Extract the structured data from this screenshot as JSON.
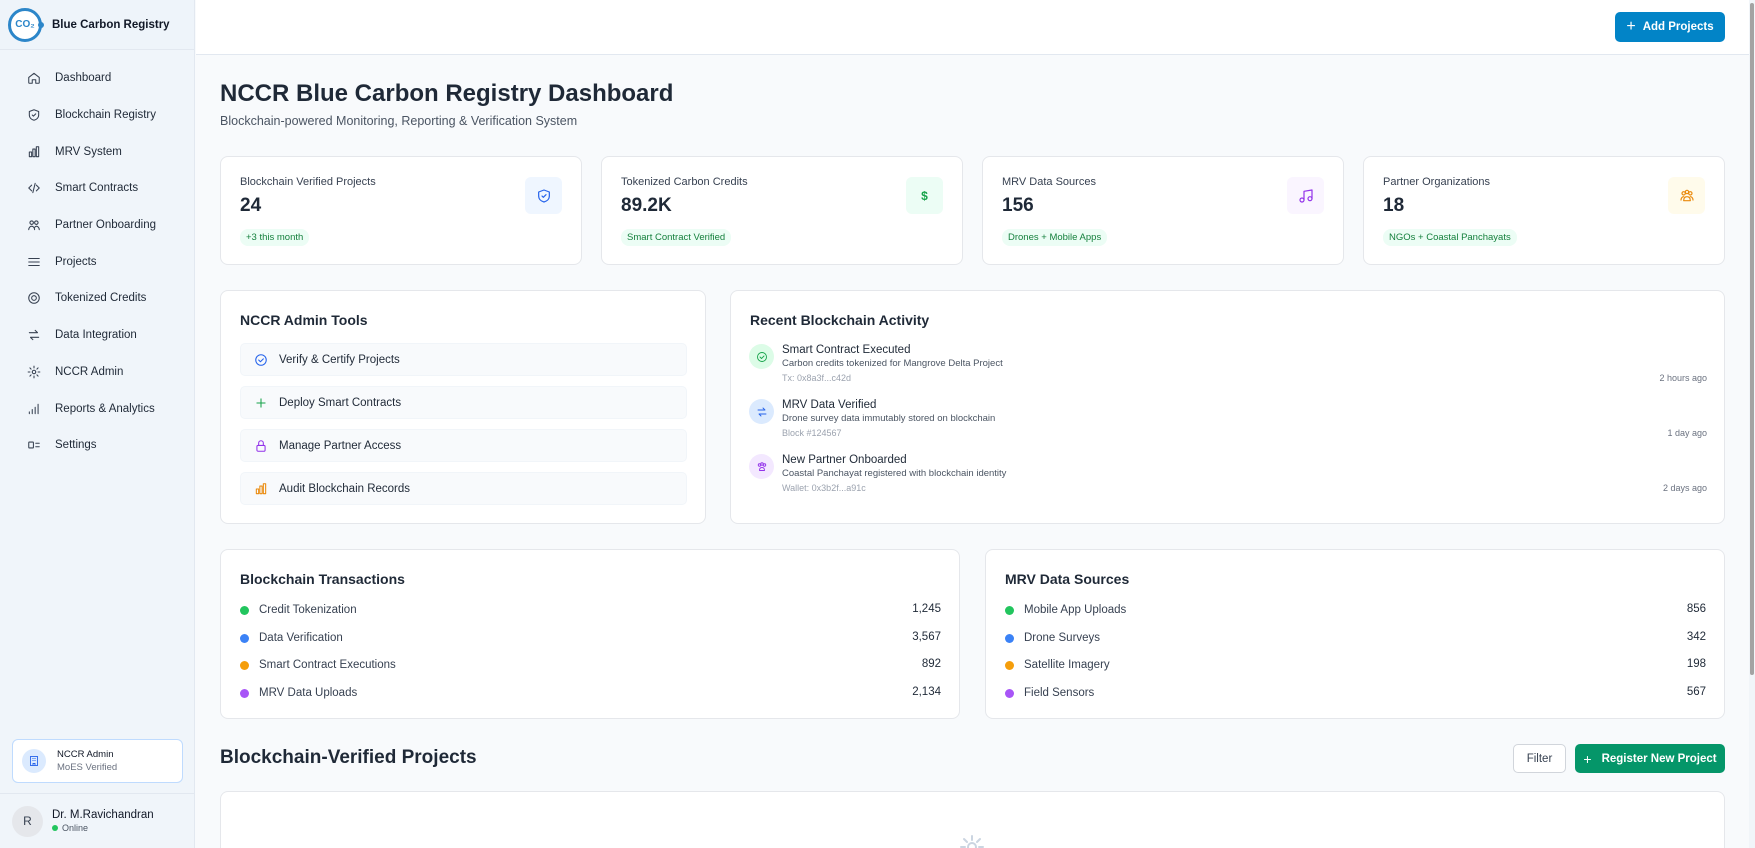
{
  "brand": {
    "logo_text": "CO₂",
    "title": "Blue Carbon Registry"
  },
  "sidebar": {
    "items": [
      {
        "label": "Dashboard",
        "icon": "home-icon"
      },
      {
        "label": "Blockchain Registry",
        "icon": "shield-icon"
      },
      {
        "label": "MRV System",
        "icon": "bar-chart-icon"
      },
      {
        "label": "Smart Contracts",
        "icon": "code-icon"
      },
      {
        "label": "Partner Onboarding",
        "icon": "users-icon"
      },
      {
        "label": "Projects",
        "icon": "list-icon"
      },
      {
        "label": "Tokenized Credits",
        "icon": "coin-icon"
      },
      {
        "label": "Data Integration",
        "icon": "arrows-icon"
      },
      {
        "label": "NCCR Admin",
        "icon": "gear-icon"
      },
      {
        "label": "Reports & Analytics",
        "icon": "signal-icon"
      },
      {
        "label": "Settings",
        "icon": "settings-icon"
      }
    ],
    "admin": {
      "name": "NCCR Admin",
      "sub": "MoES Verified"
    },
    "user": {
      "initial": "R",
      "name": "Dr. M.Ravichandran",
      "status": "Online"
    }
  },
  "topbar": {
    "add_label": "Add Projects"
  },
  "page": {
    "title": "NCCR Blue Carbon Registry Dashboard",
    "subtitle": "Blockchain-powered Monitoring, Reporting & Verification System"
  },
  "stats": [
    {
      "label": "Blockchain Verified Projects",
      "value": "24",
      "badge": "+3 this month",
      "icon": "shield-check-icon",
      "color": "#2563eb",
      "bg": "#eff6ff"
    },
    {
      "label": "Tokenized Carbon Credits",
      "value": "89.2K",
      "badge": "Smart Contract Verified",
      "icon": "dollar-icon",
      "color": "#16a34a",
      "bg": "#ecfdf5"
    },
    {
      "label": "MRV Data Sources",
      "value": "156",
      "badge": "Drones + Mobile Apps",
      "icon": "music-icon",
      "color": "#9333ea",
      "bg": "#faf5ff"
    },
    {
      "label": "Partner Organizations",
      "value": "18",
      "badge": "NGOs + Coastal Panchayats",
      "icon": "group-icon",
      "color": "#ea8a0c",
      "bg": "#fffbeb"
    }
  ],
  "admin_tools": {
    "title": "NCCR Admin Tools",
    "items": [
      {
        "label": "Verify & Certify Projects",
        "icon": "check-circle-icon",
        "color": "#2563eb"
      },
      {
        "label": "Deploy Smart Contracts",
        "icon": "plus-icon",
        "color": "#16a34a"
      },
      {
        "label": "Manage Partner Access",
        "icon": "lock-icon",
        "color": "#9333ea"
      },
      {
        "label": "Audit Blockchain Records",
        "icon": "bar-chart-icon",
        "color": "#ea8a0c"
      }
    ]
  },
  "activity": {
    "title": "Recent Blockchain Activity",
    "items": [
      {
        "title": "Smart Contract Executed",
        "desc": "Carbon credits tokenized for Mangrove Delta Project",
        "meta": "Tx: 0x8a3f...c42d",
        "time": "2 hours ago",
        "icon": "check-circle-icon",
        "color": "#16a34a",
        "bg": "#dcfce7"
      },
      {
        "title": "MRV Data Verified",
        "desc": "Drone survey data immutably stored on blockchain",
        "meta": "Block #124567",
        "time": "1 day ago",
        "icon": "arrows-icon",
        "color": "#2563eb",
        "bg": "#dbeafe"
      },
      {
        "title": "New Partner Onboarded",
        "desc": "Coastal Panchayat registered with blockchain identity",
        "meta": "Wallet: 0x3b2f...a91c",
        "time": "2 days ago",
        "icon": "group-icon",
        "color": "#9333ea",
        "bg": "#f3e8ff"
      }
    ]
  },
  "transactions": {
    "title": "Blockchain Transactions",
    "rows": [
      {
        "label": "Credit Tokenization",
        "value": "1,245",
        "color": "#22c55e"
      },
      {
        "label": "Data Verification",
        "value": "3,567",
        "color": "#3b82f6"
      },
      {
        "label": "Smart Contract Executions",
        "value": "892",
        "color": "#f59e0b"
      },
      {
        "label": "MRV Data Uploads",
        "value": "2,134",
        "color": "#a855f7"
      }
    ]
  },
  "mrv_sources": {
    "title": "MRV Data Sources",
    "rows": [
      {
        "label": "Mobile App Uploads",
        "value": "856",
        "color": "#22c55e"
      },
      {
        "label": "Drone Surveys",
        "value": "342",
        "color": "#3b82f6"
      },
      {
        "label": "Satellite Imagery",
        "value": "198",
        "color": "#f59e0b"
      },
      {
        "label": "Field Sensors",
        "value": "567",
        "color": "#a855f7"
      }
    ]
  },
  "projects_section": {
    "title": "Blockchain-Verified Projects",
    "filter_label": "Filter",
    "register_label": "Register New Project"
  }
}
